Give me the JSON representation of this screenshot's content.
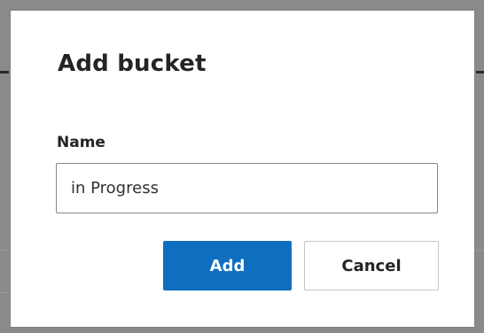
{
  "dialog": {
    "title": "Add bucket",
    "name_label": "Name",
    "name_value": "in Progress",
    "add_label": "Add",
    "cancel_label": "Cancel"
  },
  "colors": {
    "overlay": "#8a8a8a",
    "primary": "#106ebe",
    "text": "#252423"
  }
}
